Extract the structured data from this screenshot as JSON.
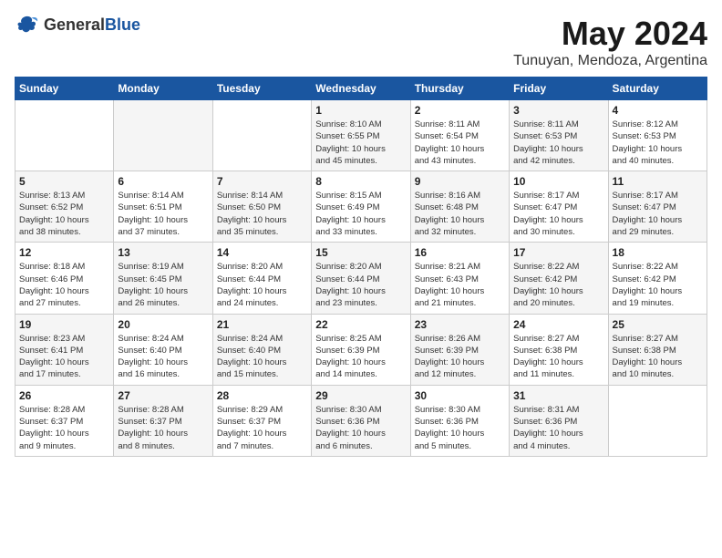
{
  "header": {
    "logo_general": "General",
    "logo_blue": "Blue",
    "month_title": "May 2024",
    "location": "Tunuyan, Mendoza, Argentina"
  },
  "columns": [
    "Sunday",
    "Monday",
    "Tuesday",
    "Wednesday",
    "Thursday",
    "Friday",
    "Saturday"
  ],
  "weeks": [
    [
      {
        "day": "",
        "info": ""
      },
      {
        "day": "",
        "info": ""
      },
      {
        "day": "",
        "info": ""
      },
      {
        "day": "1",
        "info": "Sunrise: 8:10 AM\nSunset: 6:55 PM\nDaylight: 10 hours\nand 45 minutes."
      },
      {
        "day": "2",
        "info": "Sunrise: 8:11 AM\nSunset: 6:54 PM\nDaylight: 10 hours\nand 43 minutes."
      },
      {
        "day": "3",
        "info": "Sunrise: 8:11 AM\nSunset: 6:53 PM\nDaylight: 10 hours\nand 42 minutes."
      },
      {
        "day": "4",
        "info": "Sunrise: 8:12 AM\nSunset: 6:53 PM\nDaylight: 10 hours\nand 40 minutes."
      }
    ],
    [
      {
        "day": "5",
        "info": "Sunrise: 8:13 AM\nSunset: 6:52 PM\nDaylight: 10 hours\nand 38 minutes."
      },
      {
        "day": "6",
        "info": "Sunrise: 8:14 AM\nSunset: 6:51 PM\nDaylight: 10 hours\nand 37 minutes."
      },
      {
        "day": "7",
        "info": "Sunrise: 8:14 AM\nSunset: 6:50 PM\nDaylight: 10 hours\nand 35 minutes."
      },
      {
        "day": "8",
        "info": "Sunrise: 8:15 AM\nSunset: 6:49 PM\nDaylight: 10 hours\nand 33 minutes."
      },
      {
        "day": "9",
        "info": "Sunrise: 8:16 AM\nSunset: 6:48 PM\nDaylight: 10 hours\nand 32 minutes."
      },
      {
        "day": "10",
        "info": "Sunrise: 8:17 AM\nSunset: 6:47 PM\nDaylight: 10 hours\nand 30 minutes."
      },
      {
        "day": "11",
        "info": "Sunrise: 8:17 AM\nSunset: 6:47 PM\nDaylight: 10 hours\nand 29 minutes."
      }
    ],
    [
      {
        "day": "12",
        "info": "Sunrise: 8:18 AM\nSunset: 6:46 PM\nDaylight: 10 hours\nand 27 minutes."
      },
      {
        "day": "13",
        "info": "Sunrise: 8:19 AM\nSunset: 6:45 PM\nDaylight: 10 hours\nand 26 minutes."
      },
      {
        "day": "14",
        "info": "Sunrise: 8:20 AM\nSunset: 6:44 PM\nDaylight: 10 hours\nand 24 minutes."
      },
      {
        "day": "15",
        "info": "Sunrise: 8:20 AM\nSunset: 6:44 PM\nDaylight: 10 hours\nand 23 minutes."
      },
      {
        "day": "16",
        "info": "Sunrise: 8:21 AM\nSunset: 6:43 PM\nDaylight: 10 hours\nand 21 minutes."
      },
      {
        "day": "17",
        "info": "Sunrise: 8:22 AM\nSunset: 6:42 PM\nDaylight: 10 hours\nand 20 minutes."
      },
      {
        "day": "18",
        "info": "Sunrise: 8:22 AM\nSunset: 6:42 PM\nDaylight: 10 hours\nand 19 minutes."
      }
    ],
    [
      {
        "day": "19",
        "info": "Sunrise: 8:23 AM\nSunset: 6:41 PM\nDaylight: 10 hours\nand 17 minutes."
      },
      {
        "day": "20",
        "info": "Sunrise: 8:24 AM\nSunset: 6:40 PM\nDaylight: 10 hours\nand 16 minutes."
      },
      {
        "day": "21",
        "info": "Sunrise: 8:24 AM\nSunset: 6:40 PM\nDaylight: 10 hours\nand 15 minutes."
      },
      {
        "day": "22",
        "info": "Sunrise: 8:25 AM\nSunset: 6:39 PM\nDaylight: 10 hours\nand 14 minutes."
      },
      {
        "day": "23",
        "info": "Sunrise: 8:26 AM\nSunset: 6:39 PM\nDaylight: 10 hours\nand 12 minutes."
      },
      {
        "day": "24",
        "info": "Sunrise: 8:27 AM\nSunset: 6:38 PM\nDaylight: 10 hours\nand 11 minutes."
      },
      {
        "day": "25",
        "info": "Sunrise: 8:27 AM\nSunset: 6:38 PM\nDaylight: 10 hours\nand 10 minutes."
      }
    ],
    [
      {
        "day": "26",
        "info": "Sunrise: 8:28 AM\nSunset: 6:37 PM\nDaylight: 10 hours\nand 9 minutes."
      },
      {
        "day": "27",
        "info": "Sunrise: 8:28 AM\nSunset: 6:37 PM\nDaylight: 10 hours\nand 8 minutes."
      },
      {
        "day": "28",
        "info": "Sunrise: 8:29 AM\nSunset: 6:37 PM\nDaylight: 10 hours\nand 7 minutes."
      },
      {
        "day": "29",
        "info": "Sunrise: 8:30 AM\nSunset: 6:36 PM\nDaylight: 10 hours\nand 6 minutes."
      },
      {
        "day": "30",
        "info": "Sunrise: 8:30 AM\nSunset: 6:36 PM\nDaylight: 10 hours\nand 5 minutes."
      },
      {
        "day": "31",
        "info": "Sunrise: 8:31 AM\nSunset: 6:36 PM\nDaylight: 10 hours\nand 4 minutes."
      },
      {
        "day": "",
        "info": ""
      }
    ]
  ]
}
